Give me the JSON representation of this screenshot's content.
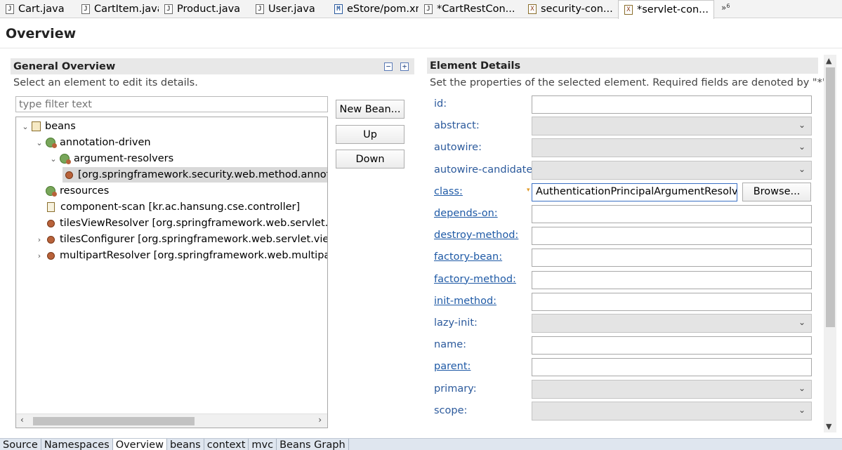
{
  "editor_tabs": [
    {
      "label": "Cart.java",
      "icon": "java-file-icon",
      "glyph": "J"
    },
    {
      "label": "CartItem.java",
      "icon": "java-file-icon",
      "glyph": "J"
    },
    {
      "label": "Product.java",
      "icon": "java-file-icon",
      "glyph": "J"
    },
    {
      "label": "User.java",
      "icon": "java-file-icon",
      "glyph": "J"
    },
    {
      "label": "eStore/pom.xml",
      "icon": "maven-file-icon",
      "glyph": "M"
    },
    {
      "label": "*CartRestCon...",
      "icon": "java-file-icon",
      "glyph": "J"
    },
    {
      "label": "security-con...",
      "icon": "xml-file-icon",
      "glyph": "X"
    },
    {
      "label": "*servlet-con...",
      "icon": "xml-file-icon",
      "glyph": "X",
      "close": "⨯"
    }
  ],
  "tab_overflow": {
    "glyph": "»",
    "count": "6"
  },
  "page": {
    "title": "Overview"
  },
  "general": {
    "title": "General Overview",
    "description": "Select an element to edit its details.",
    "collapse_glyph": "−",
    "expand_glyph": "+",
    "filter_placeholder": "type filter text",
    "tree": [
      {
        "label": "beans",
        "level": 0,
        "twisty": "⌄",
        "icon": "beans"
      },
      {
        "label": "annotation-driven",
        "level": 1,
        "twisty": "⌄",
        "icon": "ns"
      },
      {
        "label": "argument-resolvers",
        "level": 2,
        "twisty": "⌄",
        "icon": "ns"
      },
      {
        "label": "[org.springframework.security.web.method.annota",
        "level": 3,
        "twisty": "",
        "icon": "bean",
        "selected": true
      },
      {
        "label": "resources",
        "level": 1,
        "twisty": "",
        "icon": "ns"
      },
      {
        "label": "component-scan [kr.ac.hansung.cse.controller]",
        "level": 1,
        "twisty": "",
        "icon": "scan"
      },
      {
        "label": "tilesViewResolver [org.springframework.web.servlet.view",
        "level": 1,
        "twisty": "",
        "icon": "bean"
      },
      {
        "label": "tilesConfigurer [org.springframework.web.servlet.view.til",
        "level": 1,
        "twisty": "›",
        "icon": "bean"
      },
      {
        "label": "multipartResolver [org.springframework.web.multipart.c",
        "level": 1,
        "twisty": "›",
        "icon": "bean"
      }
    ],
    "scroll_left": "‹",
    "scroll_right": "›",
    "buttons": {
      "new_bean": "New Bean...",
      "up": "Up",
      "down": "Down"
    }
  },
  "details": {
    "title": "Element Details",
    "description": "Set the properties of the selected element. Required fields are denoted by \"*\".",
    "req_marker": "▾",
    "properties": [
      {
        "label": "id:",
        "type": "text",
        "value": "",
        "link": false
      },
      {
        "label": "abstract:",
        "type": "combo",
        "value": "",
        "link": false
      },
      {
        "label": "autowire:",
        "type": "combo",
        "value": "",
        "link": false
      },
      {
        "label": "autowire-candidate:",
        "type": "combo",
        "value": "",
        "link": false
      },
      {
        "label": "class:",
        "type": "text-browse",
        "value": "AuthenticationPrincipalArgumentResolver",
        "link": true
      },
      {
        "label": "depends-on:",
        "type": "text",
        "value": "",
        "link": true
      },
      {
        "label": "destroy-method:",
        "type": "text",
        "value": "",
        "link": true
      },
      {
        "label": "factory-bean:",
        "type": "text",
        "value": "",
        "link": true
      },
      {
        "label": "factory-method:",
        "type": "text",
        "value": "",
        "link": true
      },
      {
        "label": "init-method:",
        "type": "text",
        "value": "",
        "link": true
      },
      {
        "label": "lazy-init:",
        "type": "combo",
        "value": "",
        "link": false
      },
      {
        "label": "name:",
        "type": "text",
        "value": "",
        "link": false
      },
      {
        "label": "parent:",
        "type": "text",
        "value": "",
        "link": true
      },
      {
        "label": "primary:",
        "type": "combo",
        "value": "",
        "link": false
      },
      {
        "label": "scope:",
        "type": "combo",
        "value": "",
        "link": false
      }
    ],
    "browse_label": "Browse...",
    "chevron": "⌄",
    "scroll_up": "▲",
    "scroll_down": "▼"
  },
  "bottom_tabs": [
    "Source",
    "Namespaces",
    "Overview",
    "beans",
    "context",
    "mvc",
    "Beans Graph"
  ],
  "bottom_active": "Overview",
  "colors": {
    "link": "#1f5aa6",
    "label": "#2c5a9c",
    "header_bg": "#e8e8e8",
    "bottom_bar": "#dfe6ef"
  }
}
